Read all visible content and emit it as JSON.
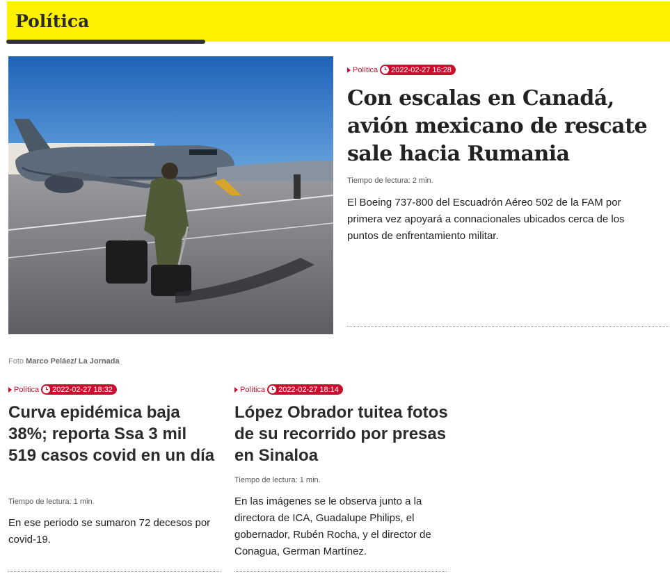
{
  "section": {
    "title": "Política"
  },
  "featured": {
    "category": "Política",
    "datetime": "2022-02-27 16:28",
    "headline": "Con escalas en Canadá, avión mexicano de rescate sale hacia Rumania",
    "read_time": "Tiempo de lectura: 2 min.",
    "summary": "El Boeing 737-800 del Escuadrón Aéreo 502 de la FAM por primera vez apoyará a connacionales ubicados cerca de los puntos de enfrentamiento militar.",
    "photo_credit_prefix": "Foto",
    "photo_credit_author": "Marco Peláez/ La Jornada"
  },
  "articles": [
    {
      "category": "Política",
      "datetime": "2022-02-27 18:32",
      "headline": "Curva epidémica baja 38%; reporta Ssa 3 mil 519 casos covid en un día",
      "read_time": "Tiempo de lectura: 1 min.",
      "summary": "En ese periodo se sumaron 72 decesos por covid-19."
    },
    {
      "category": "Política",
      "datetime": "2022-02-27 18:14",
      "headline": "López Obrador tuitea fotos de su recorrido por presas en Sinaloa",
      "read_time": "Tiempo de lectura: 1 min.",
      "summary": "En las imágenes se le observa junto a la directora de ICA, Guadalupe Philips, el gobernador, Rubén Rocha, y el director de Conagua, German Martínez."
    }
  ],
  "colors": {
    "section_bg": "#fff200",
    "accent": "#c8102e"
  },
  "icons": {
    "category_marker": "caret-right-icon",
    "time": "clock-icon"
  }
}
